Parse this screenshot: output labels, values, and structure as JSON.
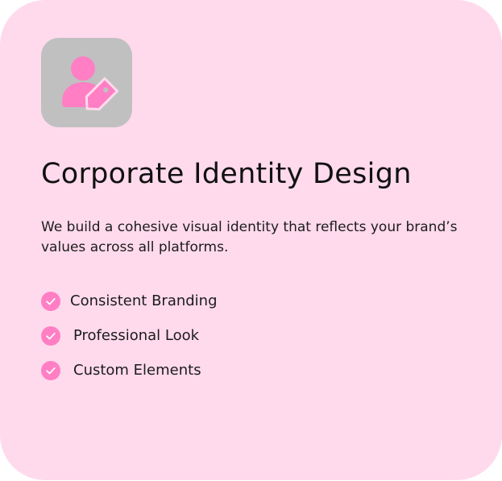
{
  "card": {
    "icon": "user-tag-icon",
    "title": "Corporate Identity Design",
    "description": "We build a cohesive visual identity that reflects your brand’s values across all platforms.",
    "features": [
      {
        "label": "Consistent Branding",
        "icon": "check-circle-icon"
      },
      {
        "label": "Professional Look",
        "icon": "check-circle-icon"
      },
      {
        "label": "Custom Elements",
        "icon": "check-circle-icon"
      }
    ]
  },
  "colors": {
    "card_background": "#ffdaec",
    "icon_tile": "#c0c0c0",
    "accent": "#ff7ec4",
    "text": "#111111"
  }
}
